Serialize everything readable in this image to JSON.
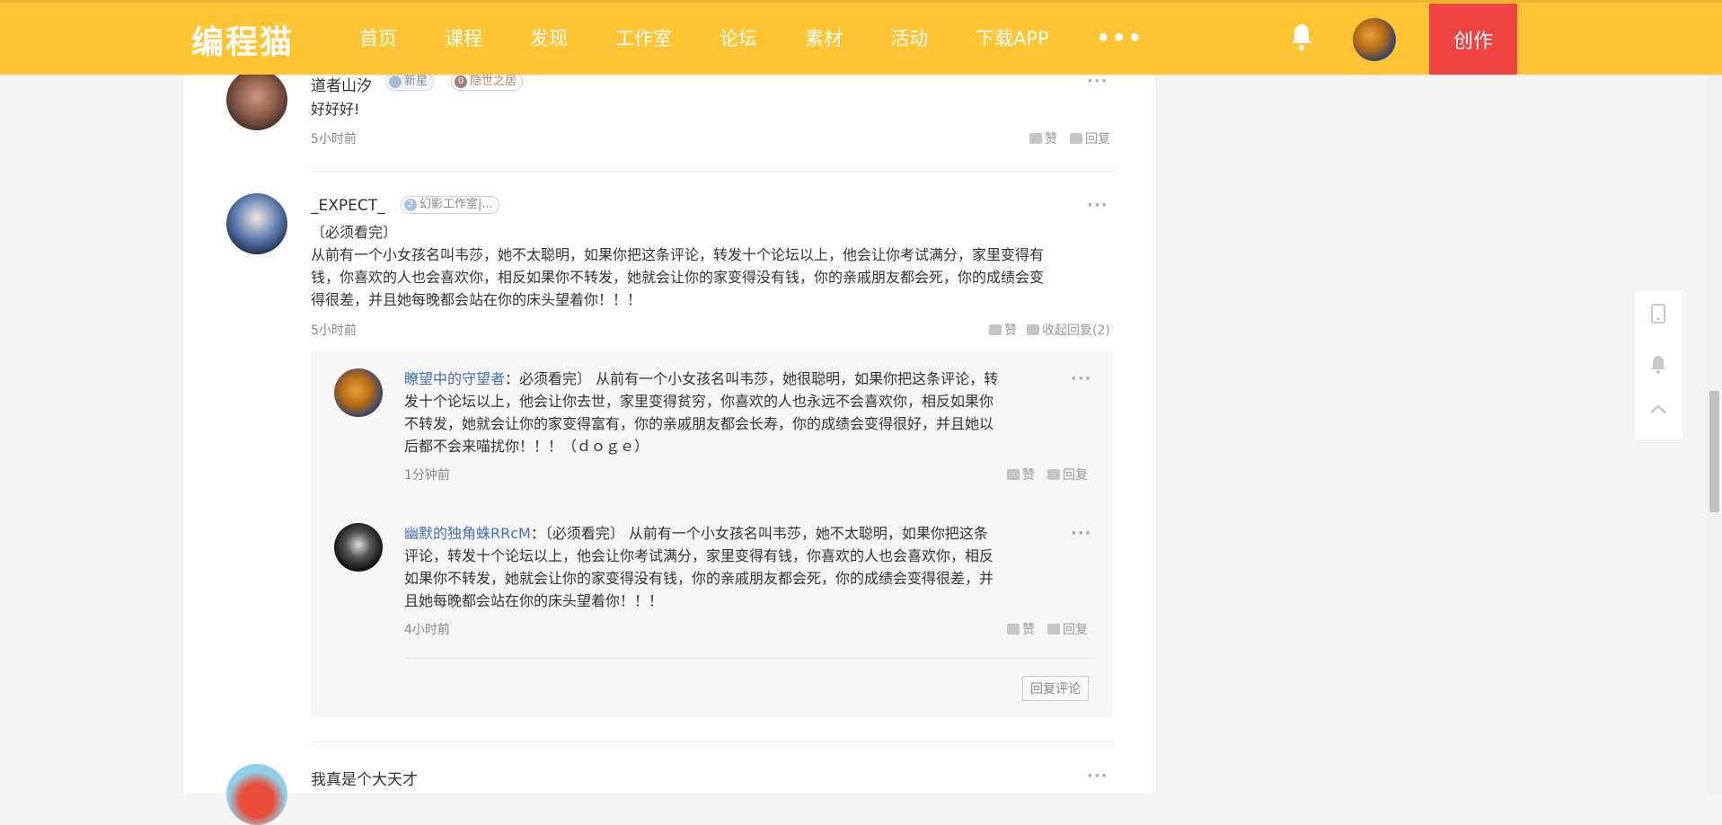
{
  "header": {
    "logo": "编程猫",
    "nav": [
      "首页",
      "课程",
      "发现",
      "工作室",
      "论坛",
      "素材",
      "活动",
      "下载APP"
    ],
    "more": "•••",
    "create": "创作"
  },
  "comments": [
    {
      "user": "道者山汐",
      "badges": [
        "新星",
        "隐世之居"
      ],
      "badge_icons": [
        "",
        "0"
      ],
      "text": "好好好!",
      "time": "5小时前",
      "like": "赞",
      "reply": "回复"
    },
    {
      "user": "_EXPECT_",
      "badges": [
        "幻影工作室|..."
      ],
      "badge_icons": [
        "2"
      ],
      "text_lines": [
        "〔必须看完〕",
        "从前有一个小女孩名叫韦莎，她不太聪明，如果你把这条评论，转发十个论坛以上，他会让你考试满分，家里变得有",
        "钱，你喜欢的人也会喜欢你，相反如果你不转发，她就会让你的家变得没有钱，你的亲戚朋友都会死，你的成绩会变",
        "得很差，并且她每晚都会站在你的床头望着你！！！"
      ],
      "time": "5小时前",
      "like": "赞",
      "reply": "收起回复(2)",
      "replies": [
        {
          "user": "瞭望中的守望者",
          "text_lines": [
            "：必须看完〕 从前有一个小女孩名叫韦莎，她很聪明，如果你把这条评论，转",
            "发十个论坛以上，他会让你去世，家里变得贫穷，你喜欢的人也永远不会喜欢你，相反如果你",
            "不转发，她就会让你的家变得富有，你的亲戚朋友都会长寿，你的成绩会变得很好，并且她以",
            "后都不会来喵扰你！！！（ｄｏｇｅ）"
          ],
          "time": "1分钟前",
          "like": "赞",
          "reply": "回复"
        },
        {
          "user": "幽默的独角蛛RRcM",
          "text_lines": [
            "：〔必须看完〕 从前有一个小女孩名叫韦莎，她不太聪明，如果你把这条",
            "评论，转发十个论坛以上，他会让你考试满分，家里变得有钱，你喜欢的人也会喜欢你，相反",
            "如果你不转发，她就会让你的家变得没有钱，你的亲戚朋友都会死，你的成绩会变得很差，并",
            "且她每晚都会站在你的床头望着你！！！"
          ],
          "time": "4小时前",
          "like": "赞",
          "reply": "回复"
        }
      ],
      "reply_comment_button": "回复评论"
    },
    {
      "user": "我真是个大天才"
    }
  ],
  "colors": {
    "header_bg": "#fec433",
    "create_bg": "#ed4343",
    "link": "#4a6fae"
  }
}
